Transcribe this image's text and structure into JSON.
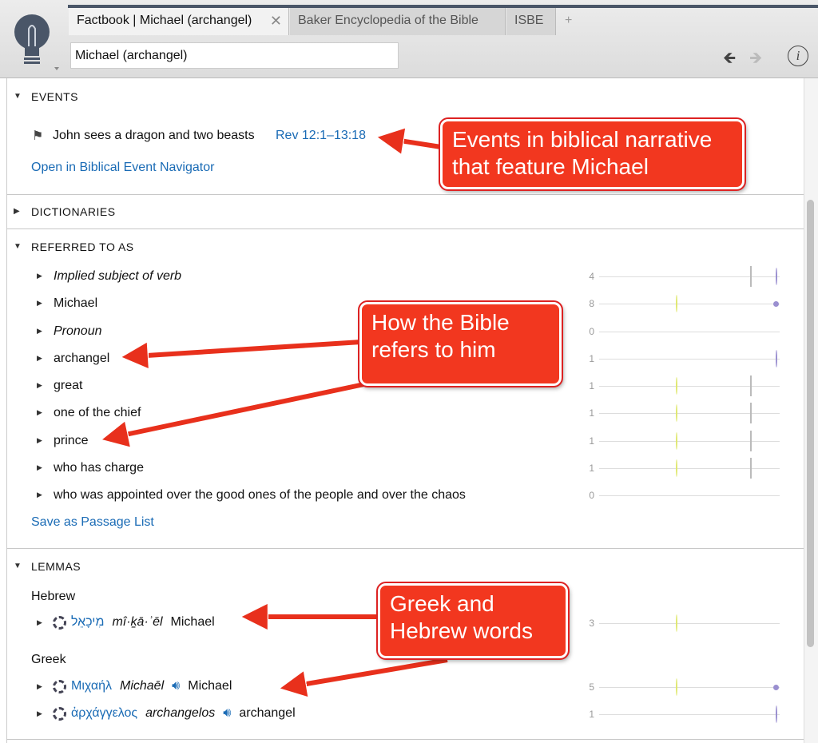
{
  "tabs": [
    {
      "label": "Factbook | Michael (archangel)",
      "active": true
    },
    {
      "label": "Baker Encyclopedia of the Bible"
    },
    {
      "label": "ISBE"
    },
    {
      "label": "+"
    }
  ],
  "search": {
    "value": "Michael (archangel)"
  },
  "sections": {
    "events": {
      "title": "EVENTS",
      "item": "John sees a dragon and two beasts",
      "ref": "Rev 12:1–13:18",
      "link": "Open in Biblical Event Navigator"
    },
    "dictionaries": {
      "title": "DICTIONARIES"
    },
    "referred": {
      "title": "REFERRED TO AS",
      "link": "Save as Passage List",
      "items": [
        {
          "label": "Implied subject of verb",
          "italic": true,
          "count": "4",
          "marks": [
            "g",
            "p"
          ]
        },
        {
          "label": "Michael",
          "count": "8",
          "marks": [
            "y",
            "pd"
          ]
        },
        {
          "label": "Pronoun",
          "italic": true,
          "count": "0",
          "marks": []
        },
        {
          "label": "archangel",
          "count": "1",
          "marks": [
            "p"
          ]
        },
        {
          "label": "great",
          "count": "1",
          "marks": [
            "y",
            "g"
          ]
        },
        {
          "label": "one of the chief",
          "count": "1",
          "marks": [
            "y",
            "g"
          ]
        },
        {
          "label": "prince",
          "count": "1",
          "marks": [
            "y",
            "g"
          ]
        },
        {
          "label": "who has charge",
          "count": "1",
          "marks": [
            "y",
            "g"
          ]
        },
        {
          "label": "who was appointed over the good ones of the people and over the chaos",
          "count": "0",
          "marks": []
        }
      ]
    },
    "lemmas": {
      "title": "LEMMAS",
      "hebrew_label": "Hebrew",
      "greek_label": "Greek",
      "hebrew": [
        {
          "word": "מִיכָאֵל",
          "translit": "mî·ḵā·ʾēl",
          "gloss": "Michael",
          "count": "3",
          "marks": [
            "y"
          ],
          "audio": false
        }
      ],
      "greek": [
        {
          "word": "Μιχαήλ",
          "translit": "Michaēl",
          "gloss": "Michael",
          "count": "5",
          "marks": [
            "y",
            "pd"
          ],
          "audio": true
        },
        {
          "word": "ἀρχάγγελος",
          "translit": "archangelos",
          "gloss": "archangel",
          "count": "1",
          "marks": [
            "p"
          ],
          "audio": true
        }
      ]
    }
  },
  "callouts": [
    "Events in biblical narrative that feature Michael",
    "How the Bible refers to him",
    "Greek and Hebrew words"
  ],
  "colors": {
    "link": "#1a6bb5",
    "callout": "#f2371f",
    "yellow_mark": "#e0e870",
    "purple_mark": "#9a8fd0"
  }
}
